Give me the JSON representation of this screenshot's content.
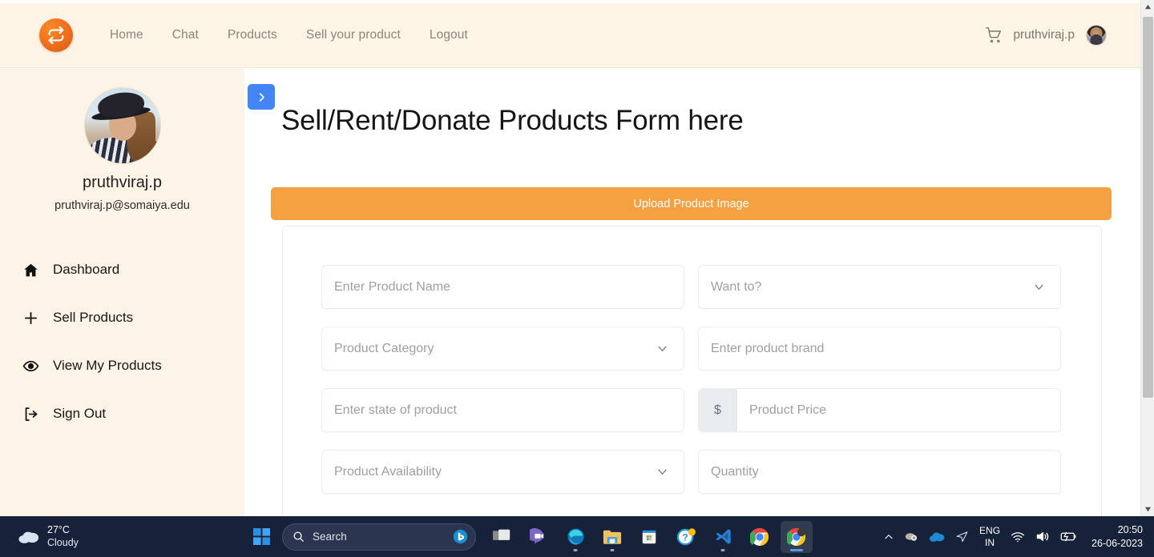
{
  "browser": {
    "scrollbar": {
      "up_icon": "scroll-up-arrow",
      "down_icon": "scroll-down-arrow"
    }
  },
  "navbar": {
    "logo_icon": "exchange-arrows-logo",
    "links": [
      {
        "label": "Home"
      },
      {
        "label": "Chat"
      },
      {
        "label": "Products"
      },
      {
        "label": "Sell your product"
      },
      {
        "label": "Logout"
      }
    ],
    "cart_icon": "shopping-cart-icon",
    "username": "pruthviraj.p",
    "avatar_icon": "user-avatar"
  },
  "sidebar": {
    "profile": {
      "photo_icon": "profile-photo",
      "name": "pruthviraj.p",
      "email": "pruthviraj.p@somaiya.edu"
    },
    "items": [
      {
        "label": "Dashboard",
        "icon": "home-icon"
      },
      {
        "label": "Sell Products",
        "icon": "plus-icon"
      },
      {
        "label": "View My Products",
        "icon": "eye-icon"
      },
      {
        "label": "Sign Out",
        "icon": "sign-out-icon"
      }
    ]
  },
  "main": {
    "toggle_icon": "chevron-right-icon",
    "title": "Sell/Rent/Donate Products Form here",
    "upload_button": "Upload Product Image",
    "form": {
      "fields": [
        {
          "name": "product-name",
          "type": "text",
          "placeholder": "Enter Product Name"
        },
        {
          "name": "want-to",
          "type": "select",
          "placeholder": "Want to?"
        },
        {
          "name": "product-category",
          "type": "select",
          "placeholder": "Product Category"
        },
        {
          "name": "product-brand",
          "type": "text",
          "placeholder": "Enter product brand"
        },
        {
          "name": "product-state",
          "type": "text",
          "placeholder": "Enter state of product"
        },
        {
          "name": "product-price",
          "type": "addon",
          "addon": "$",
          "placeholder": "Product Price"
        },
        {
          "name": "product-availability",
          "type": "select",
          "placeholder": "Product Availability"
        },
        {
          "name": "quantity",
          "type": "text",
          "placeholder": "Quantity"
        }
      ]
    }
  },
  "taskbar": {
    "weather": {
      "temperature": "27°C",
      "condition": "Cloudy",
      "icon": "cloud-icon"
    },
    "start_icon": "windows-start-icon",
    "search": {
      "placeholder": "Search",
      "icon": "search-icon",
      "bing_icon": "bing-icon"
    },
    "apps": [
      {
        "name": "task-view",
        "icon": "task-view-icon"
      },
      {
        "name": "teams-chat",
        "icon": "teams-chat-icon"
      },
      {
        "name": "microsoft-edge",
        "icon": "edge-icon"
      },
      {
        "name": "file-explorer",
        "icon": "folder-icon"
      },
      {
        "name": "microsoft-store",
        "icon": "store-icon"
      },
      {
        "name": "help-app",
        "icon": "question-circle-icon"
      },
      {
        "name": "visual-studio-code",
        "icon": "vscode-icon"
      },
      {
        "name": "google-chrome",
        "icon": "chrome-icon"
      },
      {
        "name": "google-chrome-active",
        "icon": "chrome-icon"
      }
    ],
    "tray": {
      "overflow_icon": "chevron-up-icon",
      "icons": [
        "app-tray-icon",
        "onedrive-icon",
        "location-arrow-icon"
      ],
      "language_primary": "ENG",
      "language_secondary": "IN",
      "wifi_icon": "wifi-icon",
      "volume_icon": "speaker-icon",
      "battery_icon": "battery-charging-icon",
      "time": "20:50",
      "date": "26-06-2023"
    }
  },
  "colors": {
    "brand_orange": "#f0701c",
    "cream": "#fdf3e6",
    "upload_orange": "#f6a141",
    "toggle_blue": "#4285f4",
    "taskbar": "#16213a"
  }
}
